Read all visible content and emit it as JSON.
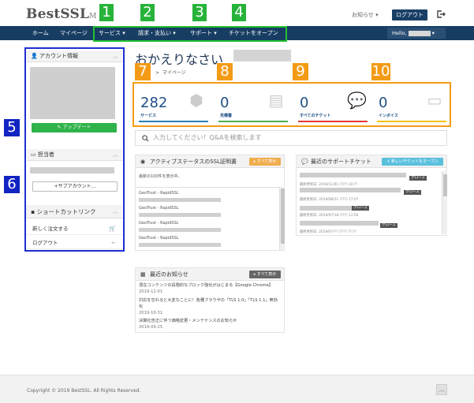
{
  "header": {
    "logo": "BestSSL",
    "logo_suffix": "M",
    "notice": "お知らせ ▾",
    "logout": "ログアウト"
  },
  "nav": {
    "home": "ホーム",
    "mypage": "マイページ",
    "service": "サービス ▾",
    "billing": "請求・支払い ▾",
    "support": "サポート ▾",
    "ticket_open": "チケットをオープン",
    "hello": "Hello,"
  },
  "badges": [
    "1",
    "2",
    "3",
    "4",
    "5",
    "6",
    "7",
    "8",
    "9",
    "10"
  ],
  "sidebar": {
    "account_info": "アカウント情報",
    "update": "アップデート",
    "staff": "担当者",
    "sub_account": "サブアカウント...",
    "shortcut": "ショートカットリンク",
    "new_order": "新しく注文する",
    "logout": "ログアウト"
  },
  "main": {
    "greeting": "おかえりなさい",
    "breadcrumb": "マイページ",
    "search_placeholder": "入力してください！Q&Aを検索します"
  },
  "stats": [
    {
      "value": "282",
      "label": "サービス",
      "color": "#2c7fb8"
    },
    {
      "value": "0",
      "label": "見積書",
      "color": "#4caf50"
    },
    {
      "value": "0",
      "label": "すべてのチケット",
      "color": "#e53935"
    },
    {
      "value": "0",
      "label": "インボイス",
      "color": "#f1c40f"
    }
  ],
  "ssl_card": {
    "title": "アクティブステータスのSSL証明書",
    "view_all": "▸ すべて表示",
    "note": "最新の100件を表示中。",
    "rows": [
      "GeoTrust - RapidSSL",
      "GeoTrust - RapidSSL",
      "GeoTrust - RapidSSL",
      "GeoTrust - RapidSSL"
    ]
  },
  "ticket_card": {
    "title": "最近のサポートチケット",
    "new_ticket": "+ 新しいチケットをオープン",
    "closed": "クローズ",
    "dates": [
      "最終更新日: 2019/11/01 (???) 10:??",
      "最終更新日: 2019/08/21 (???) 17:07",
      "最終更新日: 2019/07/18 (???) 11:56",
      "最終更新日: 2019/07/?? (???) ??:??"
    ]
  },
  "news_card": {
    "title": "最近のお知らせ",
    "view_all": "▸ すべて表示",
    "items": [
      {
        "title": "混在コンテンツの段階的なブロック強化がはじまる【Google Chrome】",
        "date": "2019-11-01"
      },
      {
        "title": "対応を忘れると大変なことに！各種ブラウザの「TLS 1.0」「TLS 1.1」無効化",
        "date": "2019-10-31"
      },
      {
        "title": "決算社告正に伴う価格変更・メンテナンスのお知らせ",
        "date": "2019-09-25"
      }
    ]
  },
  "footer": {
    "copyright": "Copyright © 2019 BestSSL. All Rights Reserved."
  }
}
